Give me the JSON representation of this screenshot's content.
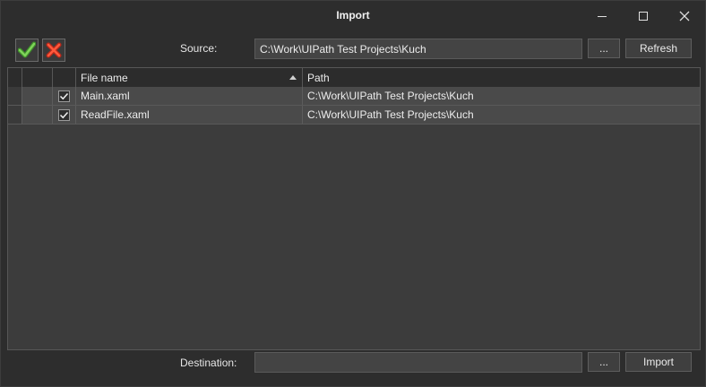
{
  "window": {
    "title": "Import"
  },
  "toolbar": {
    "select_all_icon": "green-check-icon",
    "deselect_all_icon": "red-cross-icon",
    "source_label": "Source:",
    "source_value": "C:\\Work\\UIPath Test Projects\\Kuch",
    "browse_label": "...",
    "refresh_label": "Refresh"
  },
  "grid": {
    "columns": {
      "file_name": "File name",
      "path": "Path"
    },
    "sort": "ascending",
    "rows": [
      {
        "checked": true,
        "file_name": "Main.xaml",
        "path": "C:\\Work\\UIPath Test Projects\\Kuch"
      },
      {
        "checked": true,
        "file_name": "ReadFile.xaml",
        "path": "C:\\Work\\UIPath Test Projects\\Kuch"
      }
    ]
  },
  "footer": {
    "destination_label": "Destination:",
    "destination_value": "",
    "browse_label": "...",
    "import_label": "Import"
  },
  "colors": {
    "background": "#2d2d2d",
    "grid_row": "#4a4a4a",
    "check_green": "#5cb85c",
    "cross_red": "#e8452c"
  }
}
